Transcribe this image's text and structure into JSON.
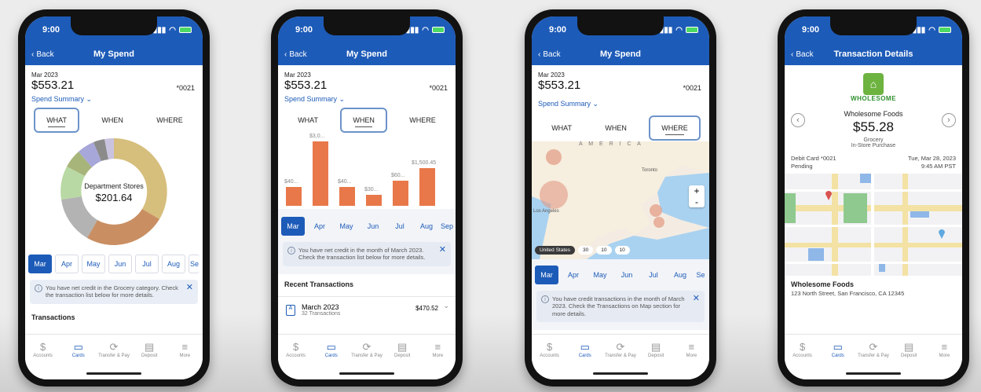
{
  "status_time": "9:00",
  "back_label": "Back",
  "account": {
    "month": "Mar 2023",
    "amount": "$553.21",
    "last4": "*0021"
  },
  "spend_summary": "Spend Summary",
  "tabs": {
    "what": "WHAT",
    "when": "WHEN",
    "where": "WHERE"
  },
  "months": [
    "Mar",
    "Apr",
    "May",
    "Jun",
    "Jul",
    "Aug",
    "Se"
  ],
  "months3": [
    "Mar",
    "Apr",
    "May",
    "Jun",
    "Jul",
    "Aug",
    "Sep"
  ],
  "bottom_nav": [
    "Accounts",
    "Cards",
    "Transfer & Pay",
    "Deposit",
    "More"
  ],
  "screen1": {
    "title": "My Spend",
    "donut_label": "Department Stores",
    "donut_value": "$201.64",
    "notice": "You have net credit in the Grocery category. Check the transaction list below for more details.",
    "section": "Transactions"
  },
  "screen2": {
    "title": "My Spend",
    "bar_labels": [
      "$40...",
      "$3,0...",
      "$40...",
      "$30...",
      "$60...",
      "$1,500.45"
    ],
    "notice": "You have net credit in the month of March 2023. Check the transaction list below for more details.",
    "recent_title": "Recent Transactions",
    "txn_month": "March 2023",
    "txn_count": "32 Transactions",
    "txn_amount": "$470.52"
  },
  "screen3": {
    "title": "My Spend",
    "map_label_top": "A M E R I C A",
    "city_toronto": "Toronto",
    "city_la": "Los Angeles",
    "zoom_in": "+",
    "zoom_out": "-",
    "chips": [
      "United States",
      "30",
      "10",
      "10"
    ],
    "notice": "You have credit transactions in the month of March 2023. Check the Transactions on Map section for more details."
  },
  "screen4": {
    "title": "Transaction Details",
    "logo_text": "WHOLESOME",
    "merchant": "Wholesome Foods",
    "amount": "$55.28",
    "category": "Grocery",
    "method": "In-Store Purchase",
    "card": "Debit Card *0021",
    "state": "Pending",
    "date": "Tue, Mar 28, 2023",
    "time": "9:45 AM PST",
    "addr_name": "Wholesome Foods",
    "addr_line": "123 North Street, San Francisco, CA 12345"
  },
  "colors": {
    "brand": "#1d5bb8",
    "bar": "#e8784a"
  }
}
